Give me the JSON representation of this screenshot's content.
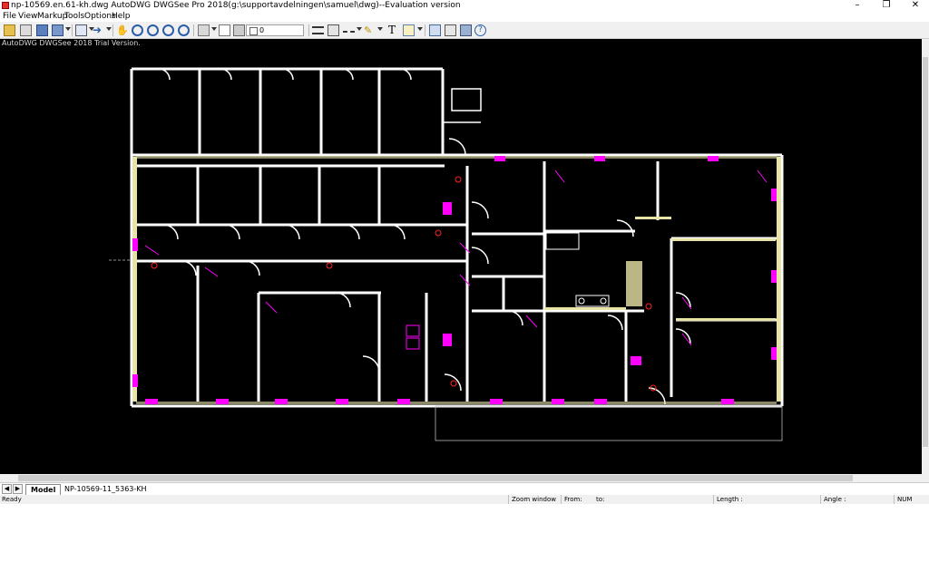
{
  "window": {
    "title": "np-10569.en.61-kh.dwg AutoDWG DWGSee Pro 2018(g:\\supportavdelningen\\samuel\\dwg)--Evaluation version",
    "minimize": "–",
    "maximize": "❐",
    "close": "✕"
  },
  "menu": {
    "items": [
      {
        "label": "File"
      },
      {
        "label": "View"
      },
      {
        "label": "Markup"
      },
      {
        "label": "Tools"
      },
      {
        "label": "Options"
      },
      {
        "label": "Help"
      }
    ]
  },
  "toolbar": {
    "layer_value": "0",
    "icons": [
      "open-icon",
      "print-icon",
      "save-icon",
      "save-as-icon",
      "screen-icon",
      "back-icon",
      "forward-icon",
      "pan-icon",
      "zoom-window-icon",
      "zoom-in-icon",
      "zoom-out-icon",
      "zoom-extents-icon",
      "layer-icon",
      "color-icon",
      "layer-combo",
      "measure-icon",
      "dimension-icon",
      "linetype-icon",
      "pen-icon",
      "text-icon",
      "comment-icon",
      "copy-icon",
      "compare-icon",
      "find-icon",
      "help-icon"
    ]
  },
  "canvas": {
    "trial_text": "AutoDWG DWGSee 2018 Trial Version.",
    "background": "#000000",
    "wall_color": "#ffffff",
    "highlight_color": "#ff00ff",
    "hatch_color": "#e8e4a8"
  },
  "tabs": {
    "items": [
      {
        "label": "Model",
        "active": true
      },
      {
        "label": "NP-10569-11_5363-KH",
        "active": false
      }
    ]
  },
  "status": {
    "ready": "Ready",
    "zoom_window": "Zoom window",
    "from": "From:",
    "to": "to:",
    "length": "Length :",
    "angle": "Angle :",
    "num": "NUM"
  }
}
